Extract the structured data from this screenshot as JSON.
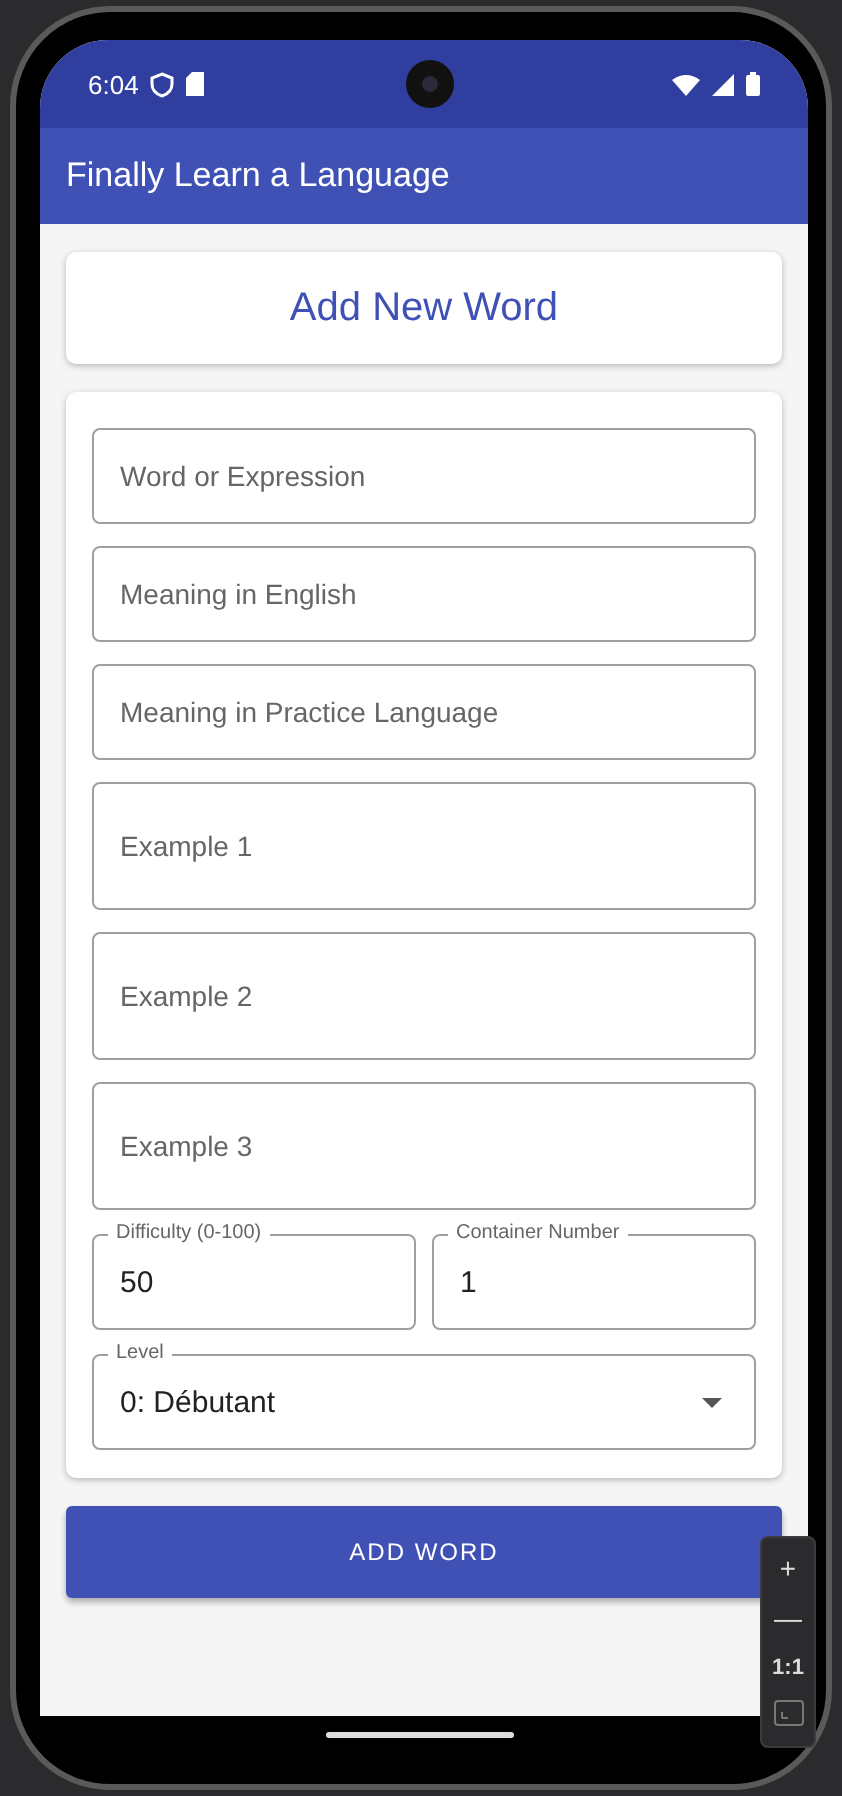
{
  "status_bar": {
    "time": "6:04"
  },
  "app_bar": {
    "title": "Finally Learn a Language"
  },
  "header_card": {
    "title": "Add New Word"
  },
  "form": {
    "fields": [
      {
        "kind": "single",
        "placeholder": "Word or Expression"
      },
      {
        "kind": "single",
        "placeholder": "Meaning in English"
      },
      {
        "kind": "single",
        "placeholder": "Meaning in Practice Language"
      },
      {
        "kind": "multi",
        "placeholder": "Example 1"
      },
      {
        "kind": "multi",
        "placeholder": "Example 2"
      },
      {
        "kind": "multi",
        "placeholder": "Example 3"
      }
    ],
    "number_fields": [
      {
        "label": "Difficulty (0-100)",
        "value": "50"
      },
      {
        "label": "Container Number",
        "value": "1"
      }
    ],
    "level_select": {
      "label": "Level",
      "value": "0: Débutant"
    }
  },
  "submit_button": {
    "label": "ADD WORD"
  },
  "emulator_toolbar": {
    "buttons": [
      "+",
      "—",
      "1:1"
    ]
  }
}
